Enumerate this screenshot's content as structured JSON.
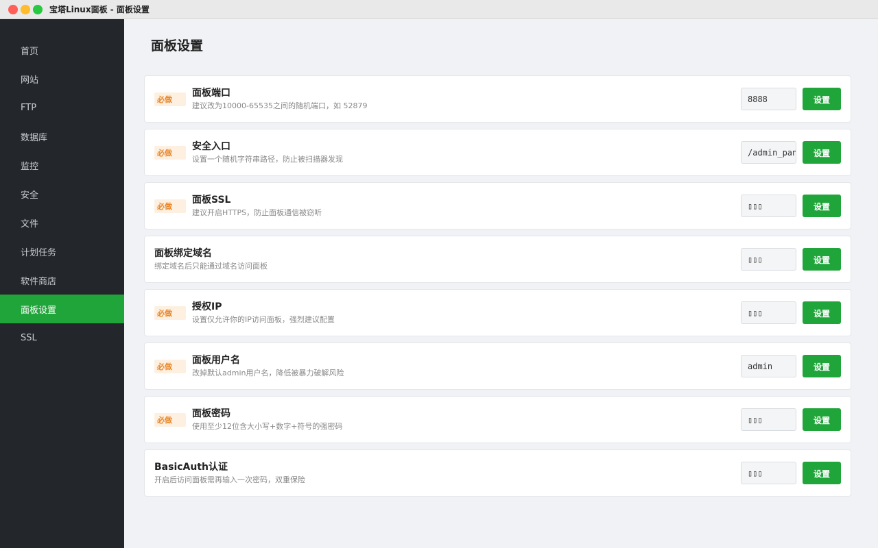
{
  "window": {
    "title": "宝塔Linux面板 - 面板设置"
  },
  "sidebar": {
    "items": [
      {
        "label": "首页",
        "active": false
      },
      {
        "label": "网站",
        "active": false
      },
      {
        "label": "FTP",
        "active": false
      },
      {
        "label": "数据库",
        "active": false
      },
      {
        "label": "监控",
        "active": false
      },
      {
        "label": "安全",
        "active": false
      },
      {
        "label": "文件",
        "active": false
      },
      {
        "label": "计划任务",
        "active": false
      },
      {
        "label": "软件商店",
        "active": false
      },
      {
        "label": "面板设置",
        "active": true
      },
      {
        "label": "SSL",
        "active": false
      }
    ]
  },
  "main": {
    "title": "面板设置",
    "settings": [
      {
        "badge": "必做",
        "title": "面板端口",
        "desc": "建议改为10000-65535之间的随机端口，如 52879",
        "value": "8888",
        "button": "设置"
      },
      {
        "badge": "必做",
        "title": "安全入口",
        "desc": "设置一个随机字符串路径，防止被扫描器发现",
        "value": "/admin_panel",
        "button": "设置"
      },
      {
        "badge": "必做",
        "title": "面板SSL",
        "desc": "建议开启HTTPS，防止面板通信被窃听",
        "value": "▯▯▯",
        "button": "设置"
      },
      {
        "badge": "",
        "title": "面板绑定域名",
        "desc": "绑定域名后只能通过域名访问面板",
        "value": "▯▯▯",
        "button": "设置"
      },
      {
        "badge": "必做",
        "title": "授权IP",
        "desc": "设置仅允许你的IP访问面板，强烈建议配置",
        "value": "▯▯▯",
        "button": "设置"
      },
      {
        "badge": "必做",
        "title": "面板用户名",
        "desc": "改掉默认admin用户名，降低被暴力破解风险",
        "value": "admin",
        "button": "设置"
      },
      {
        "badge": "必做",
        "title": "面板密码",
        "desc": "使用至少12位含大小写+数字+符号的强密码",
        "value": "▯▯▯",
        "button": "设置"
      },
      {
        "badge": "",
        "title": "BasicAuth认证",
        "desc": "开启后访问面板需再输入一次密码，双重保险",
        "value": "▯▯▯",
        "button": "设置"
      }
    ]
  },
  "colors": {
    "accent": "#20a53a",
    "sidebar_bg": "#23262b",
    "badge_bg": "#fdf0e0",
    "badge_text": "#e8862a"
  }
}
